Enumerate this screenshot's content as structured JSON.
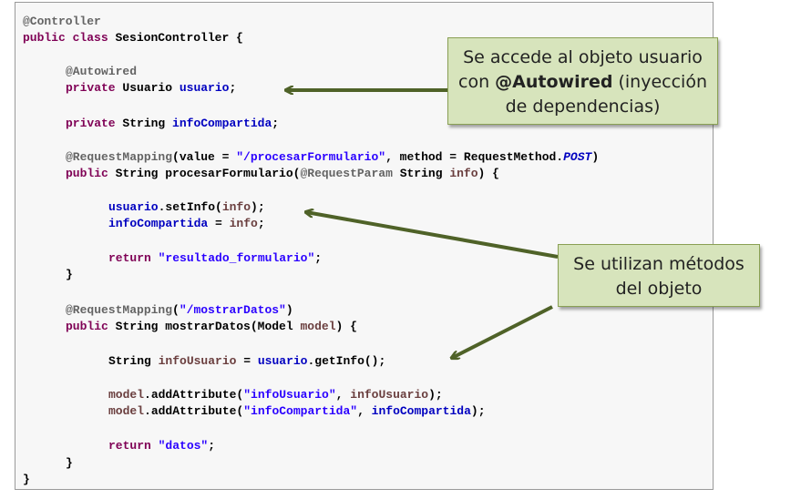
{
  "code": {
    "l01": "@Controller",
    "l02_kw": "public class",
    "l02_name": "SesionController {",
    "l03": "@Autowired",
    "l04_kw": "private",
    "l04_type": "Usuario",
    "l04_field": "usuario",
    "l05_kw": "private",
    "l05_type": "String",
    "l05_field": "infoCompartida",
    "l06_ann": "@RequestMapping",
    "l06_a": "(value = ",
    "l06_str": "\"/procesarFormulario\"",
    "l06_b": ", method = RequestMethod.",
    "l06_post": "POST",
    "l06_c": ")",
    "l07_kw": "public",
    "l07_a": "String procesarFormulario(",
    "l07_ann": "@RequestParam",
    "l07_b": "String",
    "l07_param": "info",
    "l07_c": ") {",
    "l08_obj": "usuario",
    "l08_a": ".setInfo(",
    "l08_param": "info",
    "l08_b": ");",
    "l09_field": "infoCompartida",
    "l09_a": " = ",
    "l09_param": "info",
    "l09_b": ";",
    "l10_kw": "return",
    "l10_str": "\"resultado_formulario\"",
    "l10_a": ";",
    "l11": "}",
    "l12_ann": "@RequestMapping",
    "l12_a": "(",
    "l12_str": "\"/mostrarDatos\"",
    "l12_b": ")",
    "l13_kw": "public",
    "l13_a": "String mostrarDatos(Model",
    "l13_param": "model",
    "l13_b": ") {",
    "l14_a": "String",
    "l14_var": "infoUsuario",
    "l14_b": " = ",
    "l14_obj": "usuario",
    "l14_c": ".getInfo();",
    "l15_param": "model",
    "l15_a": ".addAttribute(",
    "l15_str": "\"infoUsuario\"",
    "l15_b": ", ",
    "l15_var": "infoUsuario",
    "l15_c": ");",
    "l16_param": "model",
    "l16_a": ".addAttribute(",
    "l16_str": "\"infoCompartida\"",
    "l16_b": ", ",
    "l16_field": "infoCompartida",
    "l16_c": ");",
    "l17_kw": "return",
    "l17_str": "\"datos\"",
    "l17_a": ";",
    "l18": "}",
    "l19": "}"
  },
  "callouts": {
    "autowired": {
      "line1": "Se accede al objeto usuario",
      "line2_pre": "con ",
      "line2_bold": "@Autowired",
      "line2_post": " (inyección",
      "line3": "de dependencias)"
    },
    "methods": {
      "line1": "Se utilizan métodos",
      "line2": "del objeto"
    }
  },
  "colors": {
    "callout_fill": "#d7e4bc",
    "callout_border": "#8aa054",
    "arrow": "#4f6228"
  }
}
